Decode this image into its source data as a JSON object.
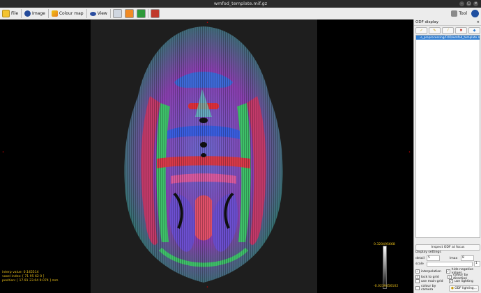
{
  "window": {
    "title": "wmfod_template.mif.gz"
  },
  "toolbar": {
    "file_label": "File",
    "image_label": "Image",
    "colourmap_label": "Colour map",
    "view_label": "View",
    "tool_label": "Tool"
  },
  "viewport": {
    "overlay_lines": [
      "interp value: 0.145514",
      "voxel index: [ 71 95 62 0 ]",
      "position: [ 17.91 23.04 9.074 ] mm"
    ],
    "colourbar_max": "0.320495668",
    "colourbar_min": "-0.0239456102"
  },
  "panel": {
    "title": "ODF display",
    "file_item": "…e_preprocessing/FOD/wmfod_template.mif.gz",
    "inspect_label": "Inspect ODF at focus",
    "settings_title": "Display settings",
    "detail_label": "detail",
    "detail_value": "5",
    "lmax_label": "lmax",
    "lmax_value": "8",
    "scale_label": "scale",
    "scale_value": "1",
    "interpolation_label": "interpolation",
    "hide_negative_label": "hide negative values",
    "lock_to_grid_label": "lock to grid",
    "colour_by_direction_label": "colour by direction",
    "use_main_grid_label": "use main grid",
    "use_lighting_label": "use lighting",
    "colour_by_camera_label": "colour by camera",
    "odf_lighting_label": "ODF lighting..."
  },
  "colors": {
    "accent": "#2f7dd1",
    "overlay_text": "#f0c419",
    "toolbar_bg": "#ececec"
  }
}
